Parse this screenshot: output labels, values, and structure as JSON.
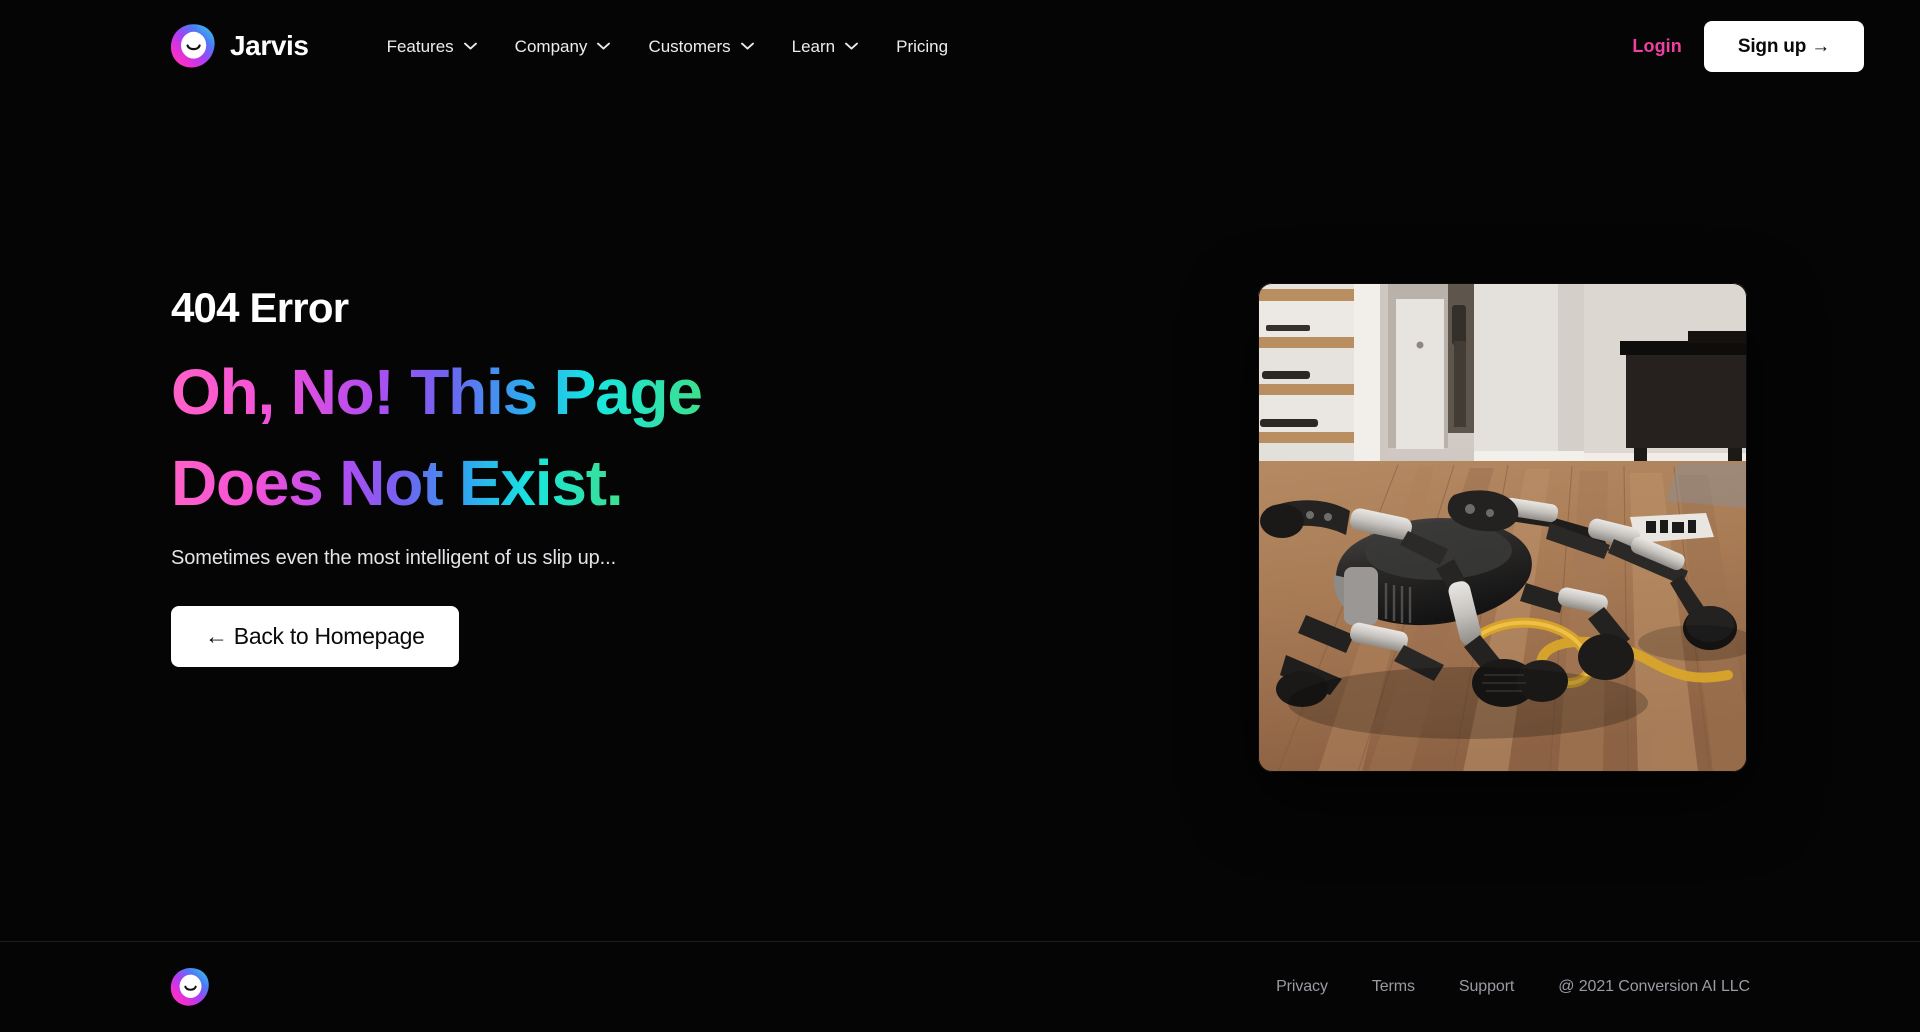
{
  "brand": {
    "name": "Jarvis",
    "logo_icon": "jarvis-smiley-blob-icon"
  },
  "header": {
    "nav": [
      {
        "label": "Features",
        "has_dropdown": true,
        "icon": "chevron-down-icon"
      },
      {
        "label": "Company",
        "has_dropdown": true,
        "icon": "chevron-down-icon"
      },
      {
        "label": "Customers",
        "has_dropdown": true,
        "icon": "chevron-down-icon"
      },
      {
        "label": "Learn",
        "has_dropdown": true,
        "icon": "chevron-down-icon"
      },
      {
        "label": "Pricing",
        "has_dropdown": false,
        "icon": ""
      }
    ],
    "login_label": "Login",
    "signup_label": "Sign up →",
    "login_color": "#ef3fa0",
    "signup_bg": "#ffffff"
  },
  "hero": {
    "eyebrow": "404 Error",
    "title_line1": "Oh, No! This Page",
    "title_line2": "Does Not Exist.",
    "subtitle": "Sometimes even the most intelligent of us slip up...",
    "cta_label": "← Back to Homepage",
    "gradient_stops": [
      "#ff61c7",
      "#f452d8",
      "#b14df0",
      "#6f63f0",
      "#2ea8ef",
      "#18e6e0",
      "#3ddf8c"
    ],
    "media_alt": "fallen-quadruped-robot-on-wooden-floor"
  },
  "footer": {
    "logo_icon": "jarvis-smiley-blob-icon",
    "links": [
      {
        "label": "Privacy"
      },
      {
        "label": "Terms"
      },
      {
        "label": "Support"
      }
    ],
    "copyright": "@ 2021 Conversion AI LLC"
  },
  "theme": {
    "background": "#050505",
    "text": "#ffffff",
    "muted_text": "#9a9aa4",
    "divider": "#1d1d1f"
  }
}
